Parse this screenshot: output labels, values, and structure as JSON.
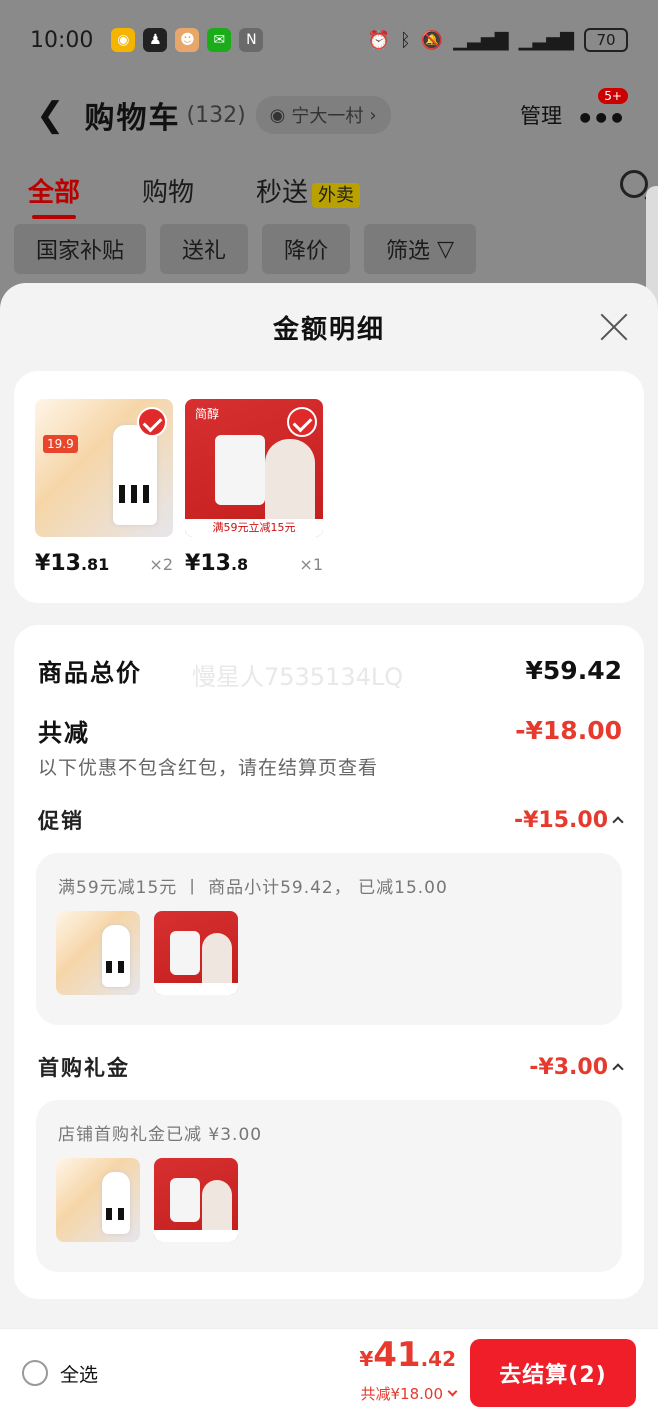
{
  "status": {
    "time": "10:00",
    "battery": "70"
  },
  "header": {
    "title": "购物车",
    "count": "(132)",
    "location": "宁大一村",
    "manage": "管理",
    "badge": "5+"
  },
  "tabs": [
    {
      "label": "全部"
    },
    {
      "label": "购物"
    },
    {
      "label": "秒送"
    }
  ],
  "tab_tag": "外卖",
  "filters": [
    "国家补贴",
    "送礼",
    "降价",
    "筛选"
  ],
  "sheet": {
    "title": "金额明细",
    "items": [
      {
        "currency": "¥",
        "price_int": "13",
        "price_dec": ".81",
        "qty": "×2"
      },
      {
        "currency": "¥",
        "price_int": "13",
        "price_dec": ".8",
        "qty": "×1"
      }
    ],
    "item_text": {
      "milk_promo": "19.9",
      "red_header": "简醇",
      "red_tagline": "满59元立减15元"
    },
    "summary": {
      "total_label": "商品总价",
      "total_value": "¥59.42",
      "watermark": "慢星人7535134LQ",
      "discount_label": "共减",
      "discount_value": "-¥18.00",
      "discount_note": "以下优惠不包含红包，请在结算页查看",
      "promo_label": "促销",
      "promo_value": "-¥15.00",
      "promo_desc": "满59元减15元 丨 商品小计59.42， 已减15.00",
      "gift_label": "首购礼金",
      "gift_value": "-¥3.00",
      "gift_desc": "店铺首购礼金已减 ¥3.00"
    }
  },
  "bottom": {
    "select_all": "全选",
    "currency": "¥",
    "total_int": "41",
    "total_dec": ".42",
    "saved": "共减¥18.00",
    "checkout": "去结算(2)"
  }
}
